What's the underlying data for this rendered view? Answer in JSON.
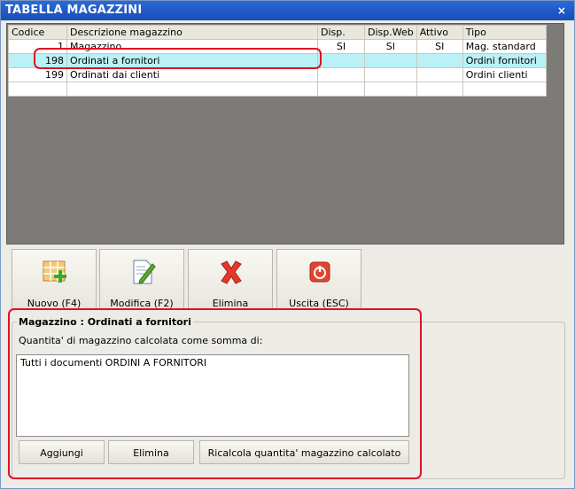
{
  "window": {
    "title": "TABELLA MAGAZZINI",
    "close_glyph": "×"
  },
  "table": {
    "columns": [
      "Codice",
      "Descrizione magazzino",
      "Disp.",
      "Disp.Web",
      "Attivo",
      "Tipo"
    ],
    "rows": [
      {
        "codice": "1",
        "descrizione": "Magazzino",
        "disp": "SI",
        "disp_web": "SI",
        "attivo": "SI",
        "tipo": "Mag. standard"
      },
      {
        "codice": "198",
        "descrizione": "Ordinati a fornitori",
        "disp": "",
        "disp_web": "",
        "attivo": "",
        "tipo": "Ordini fornitori"
      },
      {
        "codice": "199",
        "descrizione": "Ordinati dai clienti",
        "disp": "",
        "disp_web": "",
        "attivo": "",
        "tipo": "Ordini clienti"
      }
    ],
    "selected_row": 1
  },
  "toolbar": {
    "nuovo": {
      "label": "Nuovo (F4)",
      "icon": "new-grid-icon"
    },
    "modifica": {
      "label": "Modifica (F2)",
      "icon": "edit-icon"
    },
    "elimina": {
      "label": "Elimina",
      "icon": "delete-x-icon"
    },
    "uscita": {
      "label": "Uscita (ESC)",
      "icon": "power-exit-icon"
    }
  },
  "detail": {
    "group_title": "Magazzino : Ordinati a fornitori",
    "calc_label": "Quantita' di magazzino calcolata come somma di:",
    "documents": [
      "Tutti i documenti ORDINI A FORNITORI"
    ],
    "add_button": "Aggiungi",
    "remove_button": "Elimina",
    "recalc_button": "Ricalcola quantita' magazzino calcolato"
  },
  "colors": {
    "titlebar": "#1f57c4",
    "selected_row": "#b9f1f6",
    "highlight": "#e01124"
  }
}
